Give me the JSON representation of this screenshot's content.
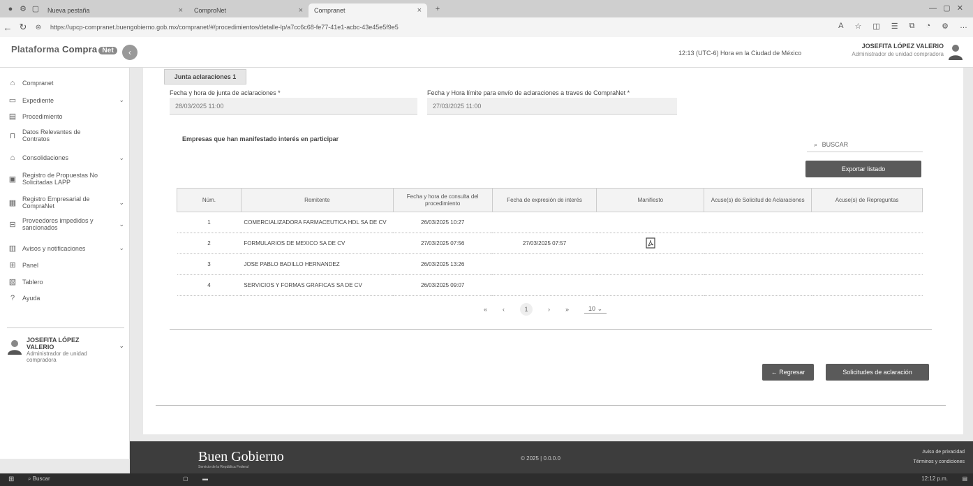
{
  "browser": {
    "tabs": [
      {
        "label": "Nueva pestaña"
      },
      {
        "label": "ComproNet"
      },
      {
        "label": "Compranet"
      }
    ],
    "url": "https://upcp-compranet.buengobierno.gob.mx/compranet/#/procedimientos/detalle-lp/a7cc6c68-fe77-41e1-acbc-43e45e5f9e5"
  },
  "header": {
    "logo_left": "Plataforma",
    "logo_main": "Compra",
    "logo_net": "Net",
    "timezone": "12:13 (UTC-6) Hora en la Ciudad de México",
    "user_name": "JOSEFITA LÓPEZ VALERIO",
    "user_role": "Administrador de unidad compradora"
  },
  "sidebar": {
    "items": [
      {
        "label": "Compranet",
        "icon": "home-icon"
      },
      {
        "label": "Expediente",
        "icon": "folder-icon",
        "chevron": "⌄"
      },
      {
        "label": "Procedimiento",
        "icon": "document-icon"
      },
      {
        "label": "Datos Relevantes de Contratos",
        "icon": "bookmark-icon"
      },
      {
        "label": "Consolidaciones",
        "icon": "building-icon",
        "chevron": "⌄"
      },
      {
        "label": "Registro de Propuestas No Solicitadas LAPP",
        "icon": "register-icon"
      },
      {
        "label": "Registro Empresarial de CompraNet",
        "icon": "briefcase-icon",
        "chevron": "⌄"
      },
      {
        "label": "Proveedores impedidos y sancionados",
        "icon": "block-icon",
        "chevron": "⌄"
      },
      {
        "label": "Avisos y notificaciones",
        "icon": "bell-icon",
        "chevron": "⌄"
      },
      {
        "label": "Panel",
        "icon": "panel-icon"
      },
      {
        "label": "Tablero",
        "icon": "chart-icon"
      },
      {
        "label": "Ayuda",
        "icon": "help-icon"
      }
    ],
    "user": {
      "name": "JOSEFITA LÓPEZ VALERIO",
      "role": "Administrador de unidad compradora"
    }
  },
  "main": {
    "tab_label": "Junta aclaraciones 1",
    "field1": {
      "label": "Fecha y hora de junta de aclaraciones *",
      "value": "28/03/2025 11:00"
    },
    "field2": {
      "label": "Fecha y Hora límite para envío de aclaraciones a traves de CompraNet *",
      "value": "27/03/2025 11:00"
    },
    "section_title": "Empresas que han manifestado interés en participar",
    "search_placeholder": "BUSCAR",
    "export_button": "Exportar listado",
    "table": {
      "headers": [
        "Núm.",
        "Remitente",
        "Fecha y hora de consulta del procedimiento",
        "Fecha de expresión de interés",
        "Manifiesto",
        "Acuse(s) de Solicitud de Aclaraciones",
        "Acuse(s) de Repreguntas"
      ],
      "rows": [
        {
          "num": "1",
          "remitente": "COMERCIALIZADORA FARMACEUTICA HDL SA DE CV",
          "fecha_consulta": "26/03/2025 10:27",
          "fecha_interes": "",
          "manifiesto": false
        },
        {
          "num": "2",
          "remitente": "FORMULARIOS DE MEXICO SA DE CV",
          "fecha_consulta": "27/03/2025 07:56",
          "fecha_interes": "27/03/2025 07:57",
          "manifiesto": true
        },
        {
          "num": "3",
          "remitente": "JOSE PABLO BADILLO HERNANDEZ",
          "fecha_consulta": "26/03/2025 13:26",
          "fecha_interes": "",
          "manifiesto": false
        },
        {
          "num": "4",
          "remitente": "SERVICIOS Y FORMAS GRAFICAS SA DE CV",
          "fecha_consulta": "26/03/2025 09:07",
          "fecha_interes": "",
          "manifiesto": false
        }
      ]
    },
    "pagination": {
      "first": "«",
      "prev": "‹",
      "current": "1",
      "next": "›",
      "last": "»",
      "page_size": "10"
    },
    "back_button": "← Regresar",
    "requests_button": "Solicitudes de aclaración"
  },
  "footer": {
    "brand": "Buen Gobierno",
    "sub": "Servicio de la República Federal",
    "center": "© 2025 | 0.0.0.0",
    "link1": "Aviso de privacidad",
    "link2": "Términos y condiciones"
  },
  "taskbar": {
    "search_label": "Buscar",
    "clock": "12:12 p.m."
  }
}
